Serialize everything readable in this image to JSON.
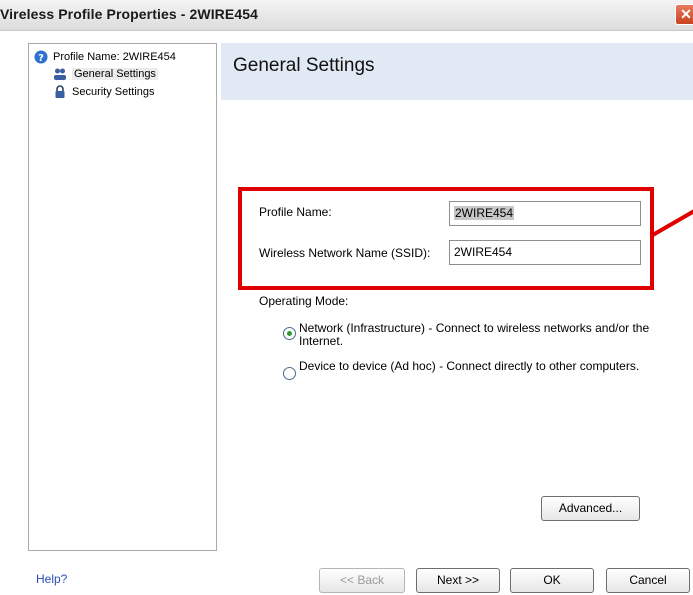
{
  "window": {
    "title": "Vireless Profile Properties - 2WIRE454",
    "close_glyph": "✕"
  },
  "tree": {
    "root_label": "Profile Name: 2WIRE454",
    "items": [
      {
        "label": "General Settings",
        "selected": true,
        "icon": "users-icon"
      },
      {
        "label": "Security Settings",
        "selected": false,
        "icon": "lock-icon"
      }
    ]
  },
  "main": {
    "header_title": "General Settings",
    "profile_name": {
      "label": "Profile Name:",
      "value": "2WIRE454"
    },
    "ssid": {
      "label": "Wireless Network Name (SSID):",
      "value": "2WIRE454"
    },
    "operating_mode": {
      "label": "Operating Mode:",
      "options": [
        {
          "label": "Network (Infrastructure) - Connect to wireless networks and/or the Internet.",
          "selected": true
        },
        {
          "label": "Device to device (Ad hoc) - Connect directly to other computers.",
          "selected": false
        }
      ]
    },
    "advanced_label": "Advanced..."
  },
  "footer": {
    "help_label": "Help?",
    "back_label": "<< Back",
    "next_label": "Next >>",
    "ok_label": "OK",
    "cancel_label": "Cancel"
  },
  "colors": {
    "highlight": "#e00000",
    "header_bg": "#e1e9f4",
    "link": "#2a4fb8"
  }
}
